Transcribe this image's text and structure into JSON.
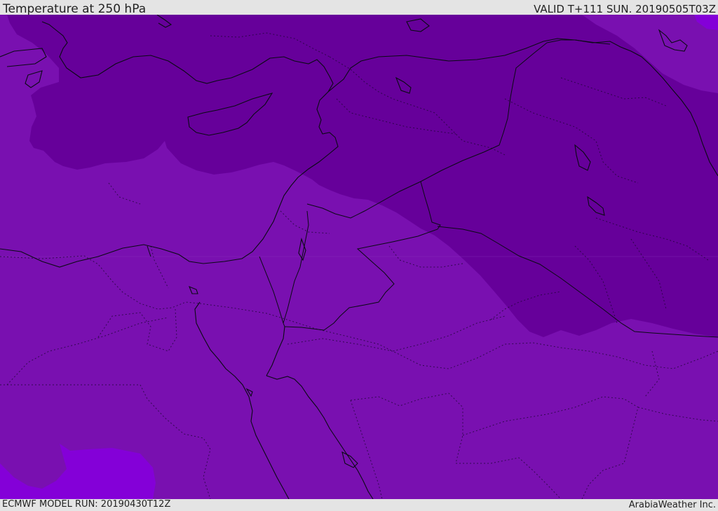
{
  "header": {
    "title": "Temperature at 250 hPa",
    "valid": "VALID T+111 SUN. 20190505T03Z"
  },
  "footer": {
    "model_run": "ECMWF MODEL RUN: 20190430T12Z",
    "credit": "ArabiaWeather Inc."
  },
  "map": {
    "colors": {
      "base": "#7910b0",
      "cold_band": "#66009a",
      "warm_patch": "#8400d8",
      "coast_line": "#0a0a14",
      "border_line": "#0a0a14"
    }
  }
}
